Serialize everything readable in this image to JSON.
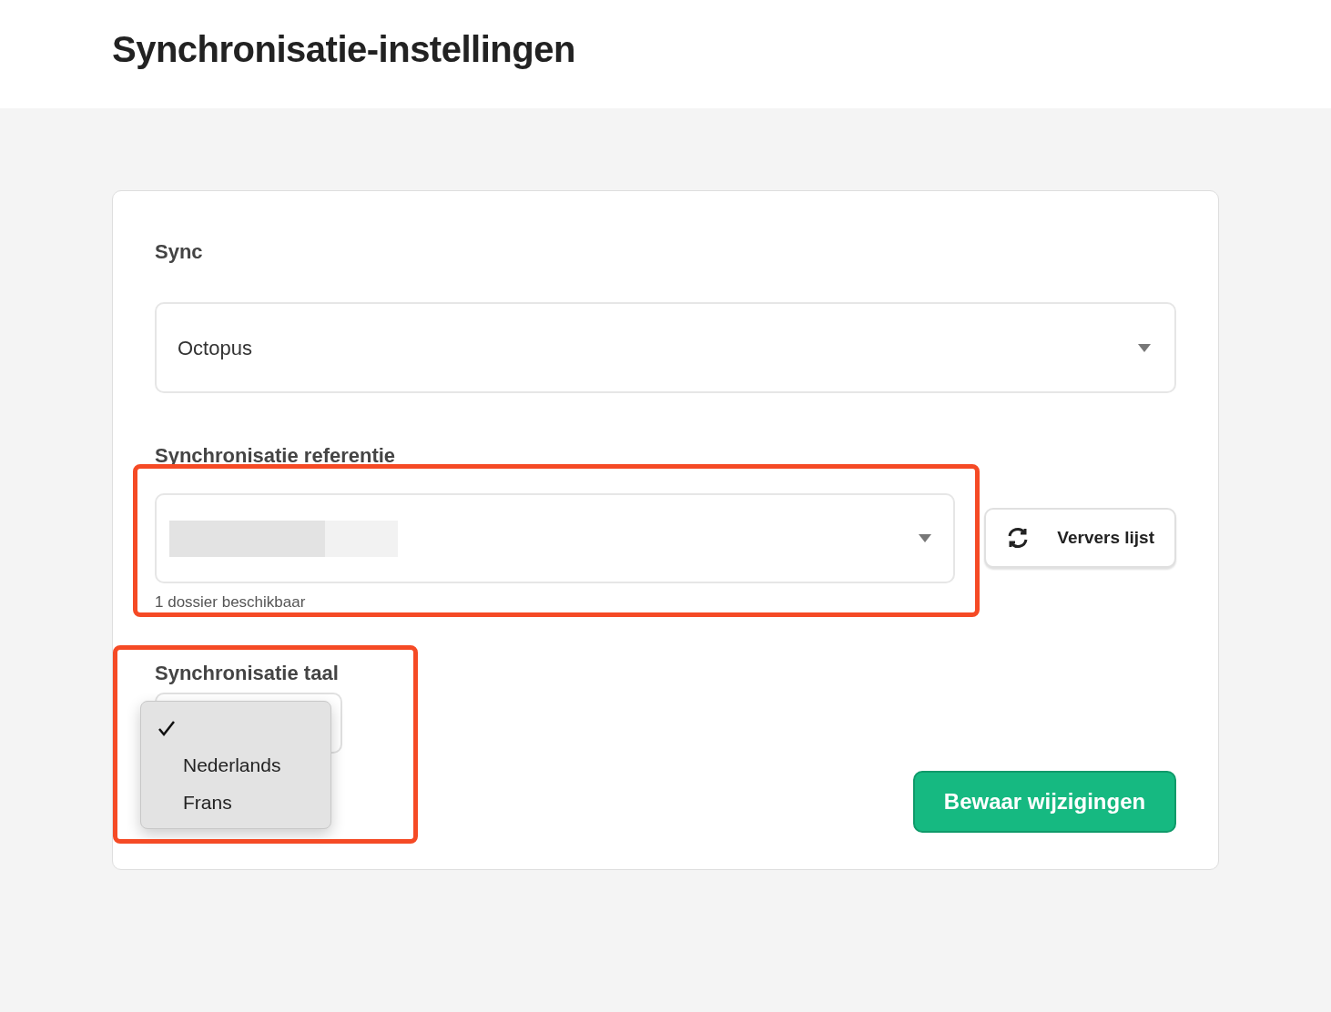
{
  "page": {
    "title": "Synchronisatie-instellingen"
  },
  "sync": {
    "label": "Sync",
    "value": "Octopus"
  },
  "reference": {
    "label": "Synchronisatie referentie",
    "redacted": true,
    "helper": "1 dossier beschikbaar",
    "highlighted": true,
    "refresh_button": "Ververs lijst"
  },
  "language": {
    "label": "Synchronisatie taal",
    "highlighted": true,
    "menu_open": true,
    "options": [
      {
        "selected": true
      },
      {
        "label": "Nederlands",
        "selected": false
      },
      {
        "label": "Frans",
        "selected": false
      }
    ]
  },
  "save_button": "Bewaar wijzigingen"
}
